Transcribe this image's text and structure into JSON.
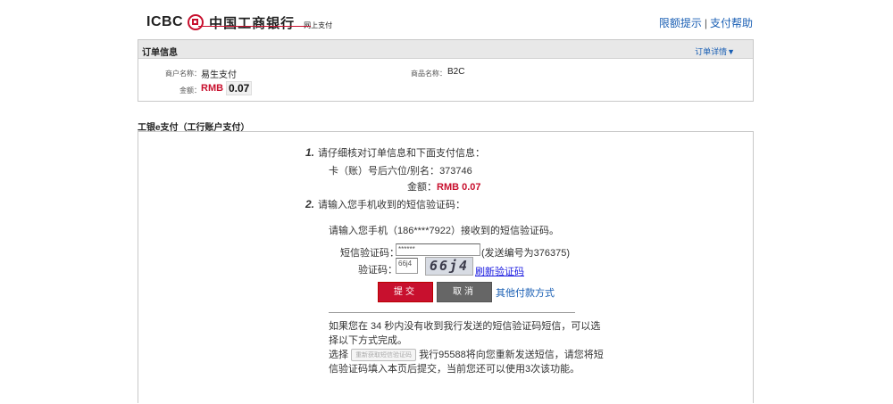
{
  "header": {
    "logo_text": "ICBC",
    "bank_name": "中国工商银行",
    "bank_sub": "网上支付",
    "links": [
      "限额提示",
      "支付帮助"
    ],
    "separator": "|"
  },
  "order_info": {
    "title": "订单信息",
    "detail_link": "订单详情▼",
    "merchant_label": "商户名称：",
    "merchant_value": "易生支付",
    "product_label": "商品名称：",
    "product_value": "B2C",
    "amount_label": "金额：",
    "amount_currency": "RMB",
    "amount_value": "0.07"
  },
  "payment": {
    "section_title": "工银e支付（工行账户支付）",
    "step1_num": "1.",
    "step1_text": "请仔细核对订单信息和下面支付信息：",
    "card_label": "卡（账）号后六位/别名：",
    "card_value": "373746",
    "amount_label": "金额：",
    "amount_value": "RMB 0.07",
    "step2_num": "2.",
    "step2_text": "请输入您手机收到的短信验证码：",
    "sms_prompt": "请输入您手机（186****7922）接收到的短信验证码。",
    "sms_label": "短信验证码：",
    "sms_value": "******",
    "sms_note": "(发送编号为376375)",
    "captcha_label": "验证码：",
    "captcha_input": "66j4",
    "captcha_image_text": "66j4",
    "refresh_link": "刷新验证码",
    "submit_label": "提交",
    "cancel_label": "取消",
    "other_link": "其他付款方式",
    "notice_line1": "如果您在 34 秒内没有收到我行发送的短信验证码短信，可以选",
    "notice_line2": "择以下方式完成。",
    "notice_choose": "选择",
    "resend_button": "重新获取短信验证码",
    "notice_line3_rest": "我行95588将向您重新发送短信，请您将短",
    "notice_line4": "信验证码填入本页后提交，当前您还可以使用3次该功能。"
  },
  "colors": {
    "brand_red": "#c8102e",
    "link_blue": "#1a5fb4"
  }
}
